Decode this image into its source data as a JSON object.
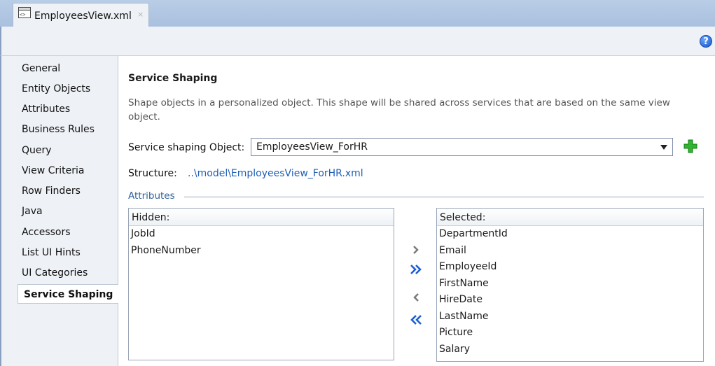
{
  "tab": {
    "title": "EmployeesView.xml",
    "close": "×",
    "file_icon": "xml-file-icon"
  },
  "toolbar": {
    "help": "?"
  },
  "nav": {
    "items": [
      {
        "label": "General"
      },
      {
        "label": "Entity Objects"
      },
      {
        "label": "Attributes"
      },
      {
        "label": "Business Rules"
      },
      {
        "label": "Query"
      },
      {
        "label": "View Criteria"
      },
      {
        "label": "Row Finders"
      },
      {
        "label": "Java"
      },
      {
        "label": "Accessors"
      },
      {
        "label": "List UI Hints"
      },
      {
        "label": "UI Categories"
      },
      {
        "label": "Service Shaping"
      }
    ],
    "selected": "Service Shaping"
  },
  "main": {
    "title": "Service Shaping",
    "description": "Shape objects in a personalized object. This shape will be shared across services that are based on the same view object.",
    "shaping_label": "Service shaping Object:",
    "shaping_value": "EmployeesView_ForHR",
    "structure_label": "Structure:",
    "structure_link": "..\\model\\EmployeesView_ForHR.xml",
    "attributes_section": "Attributes",
    "hidden": {
      "header": "Hidden:",
      "items": [
        "JobId",
        "PhoneNumber"
      ]
    },
    "selected": {
      "header": "Selected:",
      "items": [
        "DepartmentId",
        "Email",
        "EmployeeId",
        "FirstName",
        "HireDate",
        "LastName",
        "Picture",
        "Salary"
      ]
    },
    "shuttle": {
      "add": "›",
      "add_all": "»",
      "remove": "‹",
      "remove_all": "«"
    }
  },
  "colors": {
    "accent": "#1f5fb6",
    "tabstrip": "#b9cde6",
    "panel": "#eef1f6",
    "add_green": "#22a322"
  }
}
